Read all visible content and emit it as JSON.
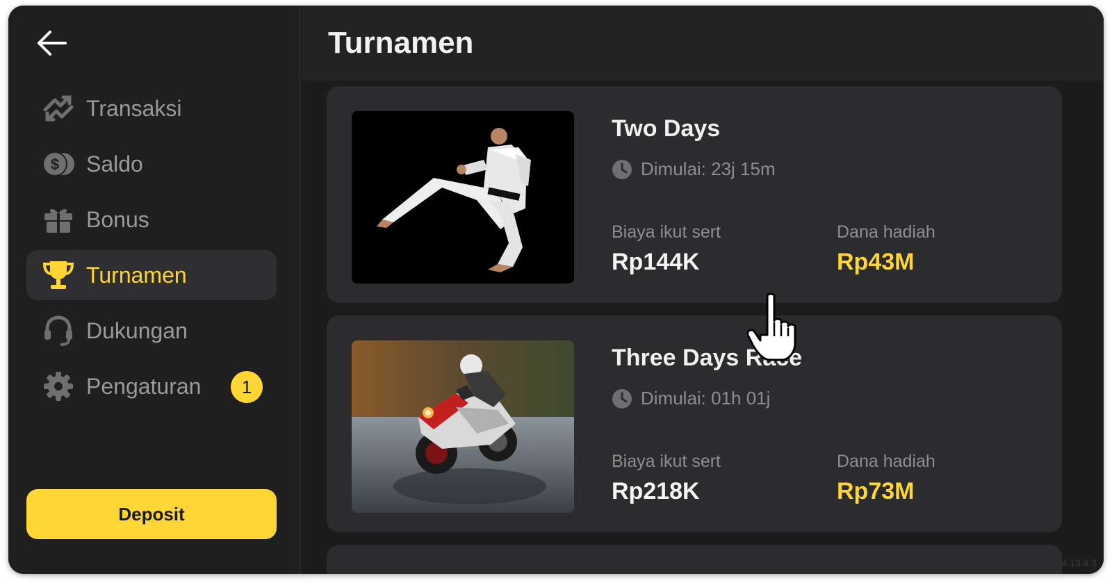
{
  "colors": {
    "accent": "#ffd633",
    "background": "#1f1f20",
    "card": "#2c2c2e",
    "muted": "#9a9a9c"
  },
  "sidebar": {
    "back_icon": "arrow-left-icon",
    "items": [
      {
        "label": "Transaksi",
        "icon": "transfer-icon"
      },
      {
        "label": "Saldo",
        "icon": "coins-icon"
      },
      {
        "label": "Bonus",
        "icon": "gift-icon"
      },
      {
        "label": "Turnamen",
        "icon": "trophy-icon",
        "active": true
      },
      {
        "label": "Dukungan",
        "icon": "headset-icon"
      },
      {
        "label": "Pengaturan",
        "icon": "gear-icon",
        "badge": "1"
      }
    ],
    "deposit_label": "Deposit"
  },
  "header": {
    "title": "Turnamen"
  },
  "tournaments": [
    {
      "title": "Two Days",
      "start": "Dimulai: 23j 15m",
      "fee_label": "Biaya ikut sert",
      "fee": "Rp144K",
      "prize_label": "Dana hadiah",
      "prize": "Rp43M",
      "image": "taekwondo-kick-photo"
    },
    {
      "title": "Three Days Race",
      "start": "Dimulai: 01h 01j",
      "fee_label": "Biaya ikut sert",
      "fee": "Rp218K",
      "prize_label": "Dana hadiah",
      "prize": "Rp73M",
      "image": "motorcycle-race-photo"
    }
  ],
  "version": "4.13.4.3"
}
